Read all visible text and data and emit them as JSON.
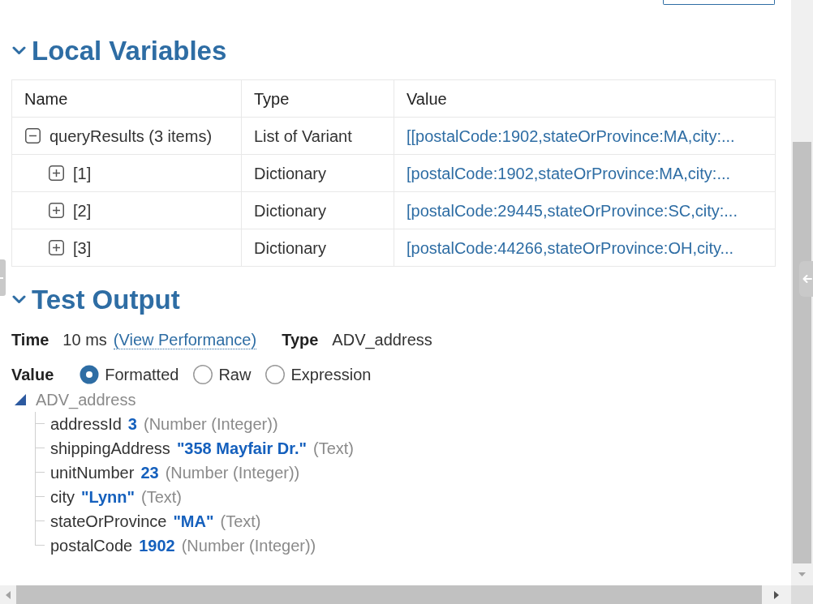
{
  "local_variables": {
    "title": "Local Variables",
    "expanded": true,
    "table": {
      "columns": [
        "Name",
        "Type",
        "Value"
      ],
      "rows": [
        {
          "name": "queryResults (3 items)",
          "type": "List of Variant",
          "value": "[[postalCode:1902,stateOrProvince:MA,city:...",
          "expanded": true,
          "children": [
            {
              "name": "[1]",
              "type": "Dictionary",
              "value": "[postalCode:1902,stateOrProvince:MA,city:...",
              "expanded": false
            },
            {
              "name": "[2]",
              "type": "Dictionary",
              "value": "[postalCode:29445,stateOrProvince:SC,city:...",
              "expanded": false
            },
            {
              "name": "[3]",
              "type": "Dictionary",
              "value": "[postalCode:44266,stateOrProvince:OH,city...",
              "expanded": false
            }
          ]
        }
      ]
    }
  },
  "test_output": {
    "title": "Test Output",
    "expanded": true,
    "time": {
      "label": "Time",
      "value": "10 ms",
      "link": "(View Performance)"
    },
    "type": {
      "label": "Type",
      "value": "ADV_address"
    },
    "value_view": {
      "label": "Value",
      "options": [
        {
          "label": "Formatted",
          "selected": true
        },
        {
          "label": "Raw",
          "selected": false
        },
        {
          "label": "Expression",
          "selected": false
        }
      ]
    },
    "result_tree": {
      "label": "ADV_address",
      "expanded": true,
      "children": [
        {
          "name": "addressId",
          "value": "3",
          "type": "(Number (Integer))"
        },
        {
          "name": "shippingAddress",
          "value": "\"358 Mayfair Dr.\"",
          "type": "(Text)"
        },
        {
          "name": "unitNumber",
          "value": "23",
          "type": "(Number (Integer))"
        },
        {
          "name": "city",
          "value": "\"Lynn\"",
          "type": "(Text)"
        },
        {
          "name": "stateOrProvince",
          "value": "\"MA\"",
          "type": "(Text)"
        },
        {
          "name": "postalCode",
          "value": "1902",
          "type": "(Number (Integer))"
        }
      ]
    }
  }
}
